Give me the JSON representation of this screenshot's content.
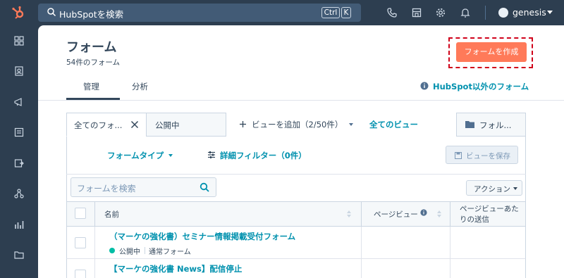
{
  "topbar": {
    "search_placeholder": "HubSpotを検索",
    "shortcut_ctrl": "Ctrl",
    "shortcut_k": "K",
    "account_name": "genesis",
    "icons": [
      "phone-icon",
      "marketplace-icon",
      "settings-gear-icon",
      "notification-bell-icon"
    ]
  },
  "leftnav": {
    "icons": [
      "dashboard-grid-icon",
      "contacts-icon",
      "marketing-megaphone-icon",
      "content-icon",
      "sales-icon",
      "automation-icon",
      "reports-icon",
      "library-folder-icon"
    ]
  },
  "page": {
    "title": "フォーム",
    "subtitle": "54件のフォーム",
    "create_button": "フォームを作成",
    "tabs": [
      {
        "label": "管理",
        "active": true
      },
      {
        "label": "分析",
        "active": false
      }
    ],
    "external_forms_link": "HubSpot以外のフォーム"
  },
  "views": {
    "tab_all": "全てのフォ...",
    "tab_published": "公開中",
    "add_view": "ビューを追加（2/50件）",
    "all_views": "全てのビュー",
    "folders": "フォル..."
  },
  "filters": {
    "form_type": "フォームタイプ",
    "advanced_filter": "詳細フィルター（0件）",
    "save_view": "ビューを保存",
    "search_placeholder": "フォームを検索",
    "actions": "アクション"
  },
  "table": {
    "headers": {
      "name": "名前",
      "page_views": "ページビュー",
      "submissions_line1": "ページビューあた",
      "submissions_line2": "りの送信"
    },
    "rows": [
      {
        "title": "（マーケの強化書）セミナー情報掲載受付フォーム",
        "status": "公開中",
        "type": "通常フォーム"
      },
      {
        "title": "【マーケの強化書 News】配信停止",
        "status": "",
        "type": ""
      }
    ]
  },
  "colors": {
    "brand_orange": "#ff7a59",
    "nav_dark": "#2d3e50",
    "link_teal": "#0091ae",
    "highlight_red": "#d0021b",
    "status_green": "#00bda5"
  }
}
